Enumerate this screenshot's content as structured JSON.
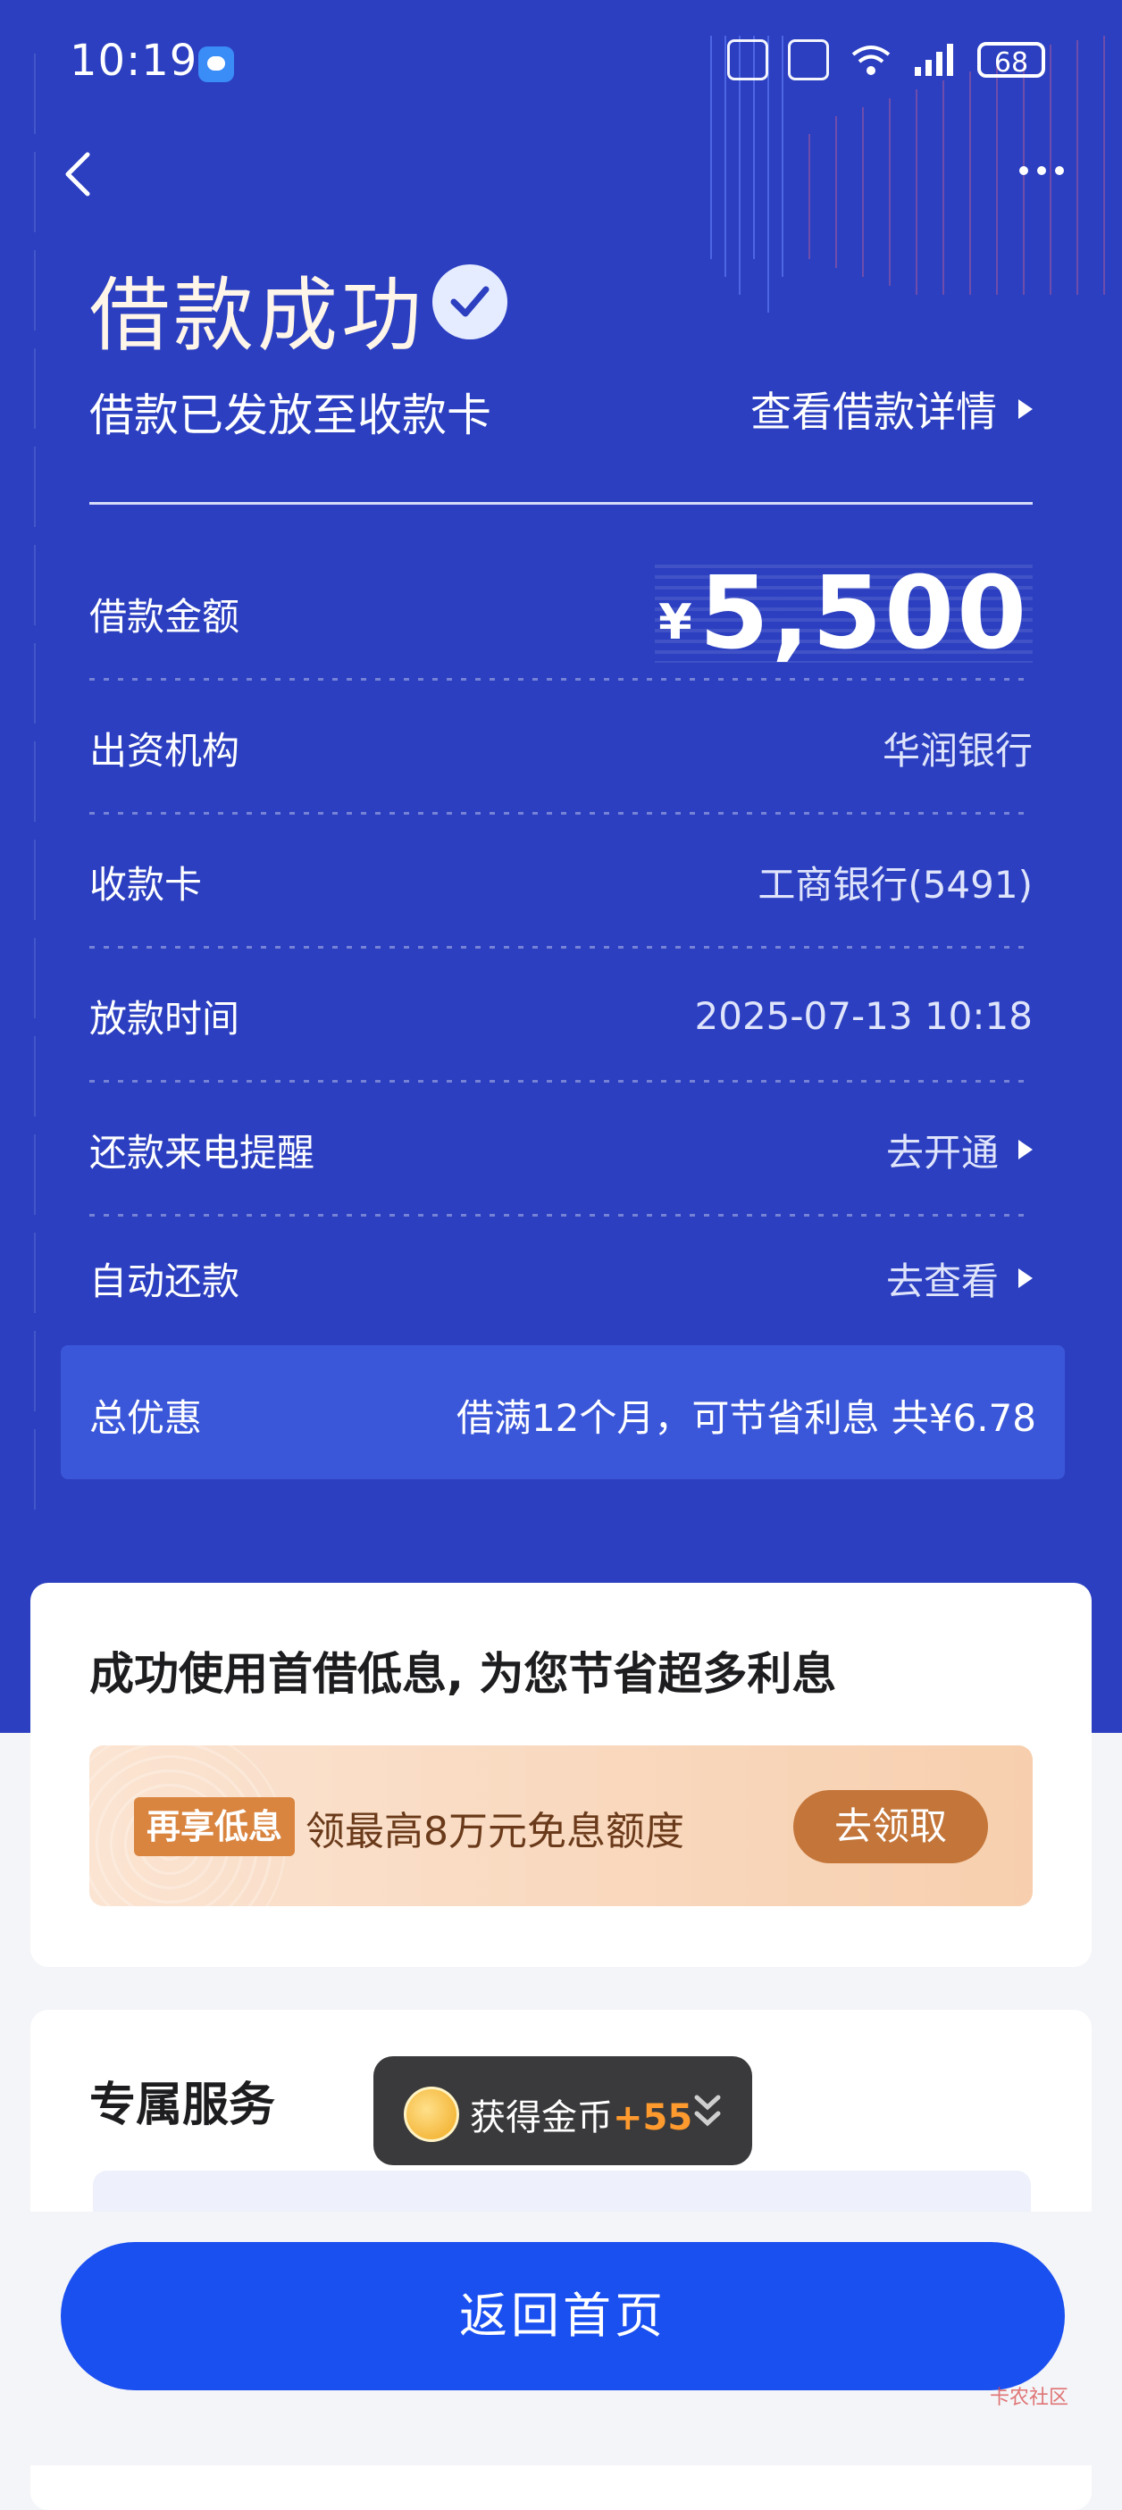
{
  "status_bar": {
    "time": "10:19",
    "battery": "68"
  },
  "header": {
    "title": "借款成功",
    "subtitle": "借款已发放至收款卡",
    "detail_link": "查看借款详情"
  },
  "details": [
    {
      "label": "借款金额",
      "currency": "¥",
      "value": "5,500"
    },
    {
      "label": "出资机构",
      "value": "华润银行"
    },
    {
      "label": "收款卡",
      "value": "工商银行(5491)"
    },
    {
      "label": "放款时间",
      "value": "2025-07-13 10:18"
    },
    {
      "label": "还款来电提醒",
      "value": "去开通"
    },
    {
      "label": "自动还款",
      "value": "去查看"
    }
  ],
  "discount": {
    "label": "总优惠",
    "value": "借满12个月，可节省利息 共¥6.78"
  },
  "promo_card": {
    "heading": "成功使用首借低息, 为您节省超多利息",
    "tag": "再享低息",
    "text": "领最高8万元免息额度",
    "button": "去领取"
  },
  "service_card": {
    "heading": "专属服务"
  },
  "toast": {
    "text": "获得金币",
    "amount": "+55"
  },
  "footer": {
    "home_button": "返回首页"
  },
  "watermark": "卡农社区",
  "colors": {
    "hero_bg": "#2b3fc0",
    "primary_button": "#1a4ff0",
    "promo_button": "#c4763a"
  }
}
